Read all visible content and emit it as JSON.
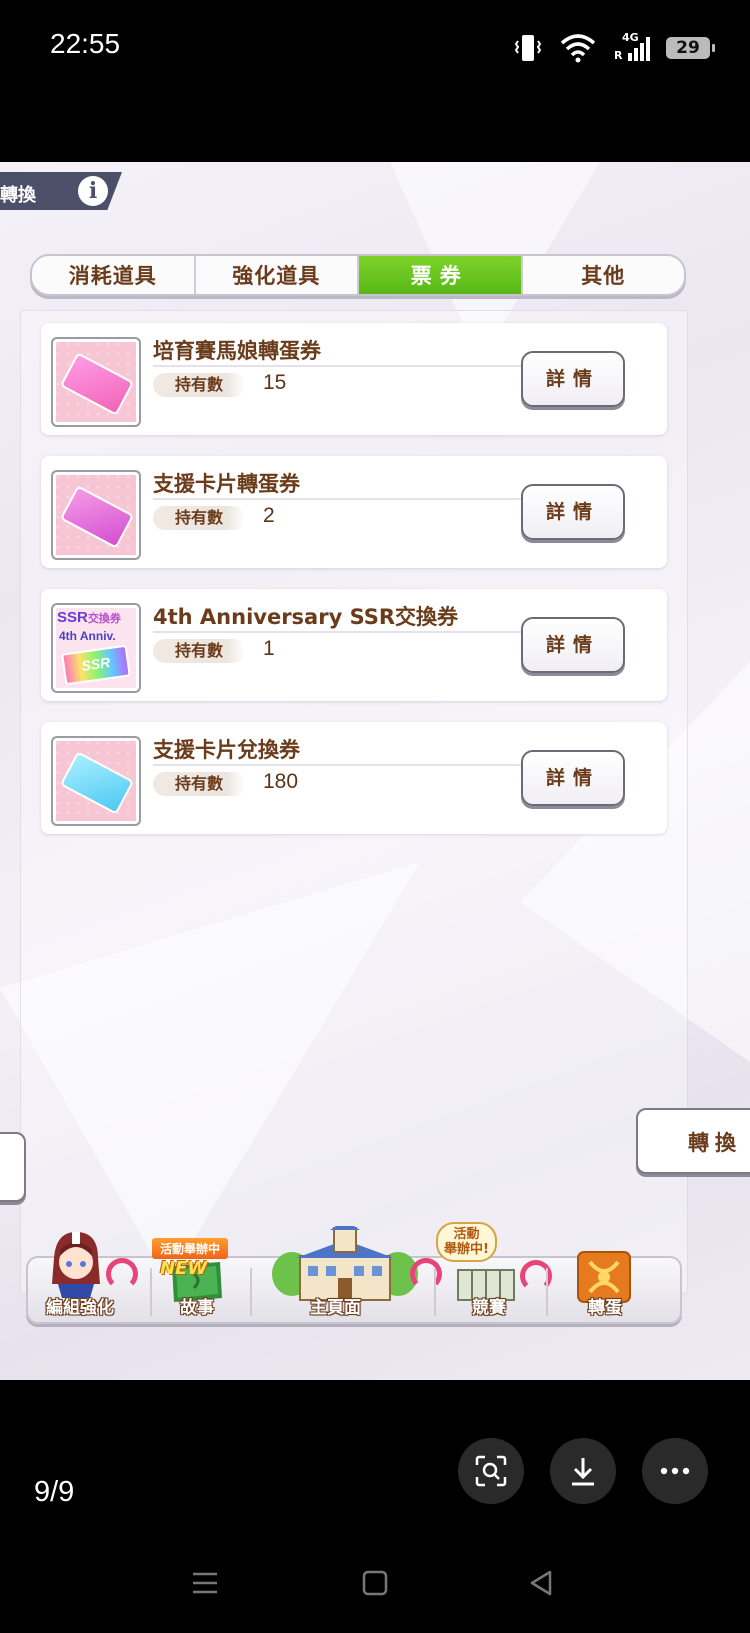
{
  "status_bar": {
    "time": "22:55",
    "network_label": "4G",
    "roaming_label": "R",
    "battery": "29"
  },
  "header": {
    "title_fragment": "轉換",
    "info_icon": "i"
  },
  "tabs": [
    {
      "label": "消耗道具",
      "active": false
    },
    {
      "label": "強化道具",
      "active": false
    },
    {
      "label": "票券",
      "active": true
    },
    {
      "label": "其他",
      "active": false
    }
  ],
  "items": [
    {
      "name": "培育賽馬娘轉蛋券",
      "owned_label": "持有數",
      "count": "15",
      "detail_label": "詳情",
      "icon": "pink-ticket-icon"
    },
    {
      "name": "支援卡片轉蛋券",
      "owned_label": "持有數",
      "count": "2",
      "detail_label": "詳情",
      "icon": "magenta-ticket-icon"
    },
    {
      "name": "4th Anniversary SSR交換券",
      "owned_label": "持有數",
      "count": "1",
      "detail_label": "詳情",
      "icon": "ssr-ticket-icon",
      "icon_text": {
        "top": "SSR",
        "top_small": "交換券",
        "mid": "4th Anniv.",
        "ticket": "SSR"
      }
    },
    {
      "name": "支援卡片兌換券",
      "owned_label": "持有數",
      "count": "180",
      "detail_label": "詳情",
      "icon": "blue-ticket-icon"
    }
  ],
  "actions": {
    "convert_label": "轉換"
  },
  "bottom_nav": {
    "items": [
      {
        "label": "編組強化"
      },
      {
        "label": "故事",
        "badge": "活動舉辦中",
        "new_label": "NEW"
      },
      {
        "label": "主頁面"
      },
      {
        "label": "競賽",
        "bubble_line1": "活動",
        "bubble_line2": "舉辦中!"
      },
      {
        "label": "轉蛋"
      }
    ]
  },
  "viewer": {
    "counter": "9/9"
  },
  "colors": {
    "tab_active": "#6cc520",
    "text_brown": "#6b3c1c",
    "horseshoe": "#e8447a"
  }
}
